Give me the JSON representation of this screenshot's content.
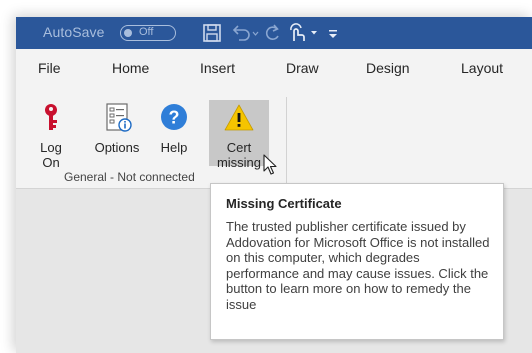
{
  "titlebar": {
    "autosave_label": "AutoSave",
    "autosave_state": "Off",
    "quick_access": [
      "save-icon",
      "undo-icon",
      "redo-icon",
      "touch-mode-icon",
      "customize-qat-icon"
    ],
    "color": "#2b579a"
  },
  "tabs": [
    "File",
    "Home",
    "Insert",
    "Draw",
    "Design",
    "Layout"
  ],
  "ribbon": {
    "buttons": {
      "logon": {
        "line1": "Log",
        "line2": "On",
        "icon": "key-icon"
      },
      "options": {
        "line1": "Options",
        "icon": "options-icon"
      },
      "help": {
        "line1": "Help",
        "icon": "help-icon"
      },
      "cert": {
        "line1": "Cert",
        "line2": "missing",
        "icon": "warning-icon"
      }
    },
    "group_label": "General - Not connected"
  },
  "tooltip": {
    "title": "Missing Certificate",
    "body": "The trusted publisher certificate issued by Addovation for Microsoft Office is not installed on this computer, which degrades performance and may cause issues. Click the button to learn more on how to remedy the issue"
  }
}
